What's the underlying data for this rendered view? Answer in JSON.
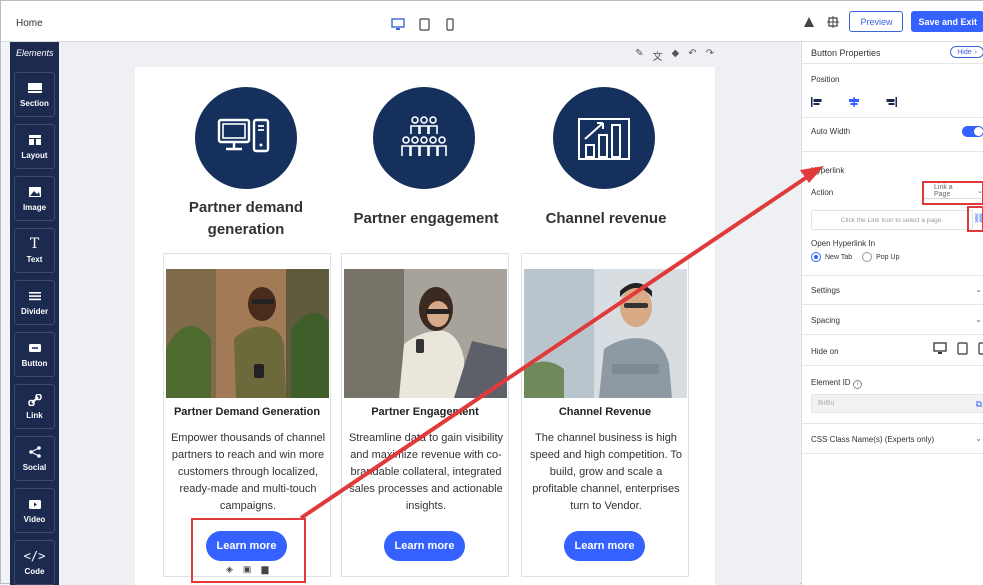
{
  "topbar": {
    "home": "Home",
    "preview": "Preview",
    "save": "Save and Exit"
  },
  "sidebar": {
    "title": "Elements",
    "items": [
      {
        "label": "Section",
        "icon": "section-icon"
      },
      {
        "label": "Layout",
        "icon": "layout-icon"
      },
      {
        "label": "Image",
        "icon": "image-icon"
      },
      {
        "label": "Text",
        "icon": "text-icon"
      },
      {
        "label": "Divider",
        "icon": "divider-icon"
      },
      {
        "label": "Button",
        "icon": "button-icon"
      },
      {
        "label": "Link",
        "icon": "link-icon"
      },
      {
        "label": "Social",
        "icon": "social-icon"
      },
      {
        "label": "Video",
        "icon": "video-icon"
      },
      {
        "label": "Code",
        "icon": "code-icon"
      }
    ]
  },
  "canvas": {
    "headings": [
      "Partner demand generation",
      "Partner engagement",
      "Channel revenue"
    ],
    "cards": [
      {
        "title": "Partner Demand Generation",
        "body": "Empower thousands of channel partners to reach and win more customers through localized, ready-made and multi-touch campaigns.",
        "button": "Learn more"
      },
      {
        "title": "Partner Engagement",
        "body": "Streamline data to gain visibility and maximize revenue with co-brandable collateral, integrated sales processes and actionable insights.",
        "button": "Learn more"
      },
      {
        "title": "Channel Revenue",
        "body": "The channel business is high speed and high competition. To build, grow and scale a profitable channel, enterprises turn to Vendor.",
        "button": "Learn more"
      }
    ],
    "accent_color": "#3461ff",
    "circle_color": "#16305e",
    "highlight_color": "#e03a3a"
  },
  "panel": {
    "title": "Button Properties",
    "hide": "Hide",
    "position_label": "Position",
    "auto_width": "Auto Width",
    "hyperlink": "Hyperlink",
    "action_label": "Action",
    "action_value": "Link a Page",
    "link_placeholder": "Click the Link Icon to select a page.",
    "open_in": "Open Hyperlink In",
    "new_tab": "New Tab",
    "pop_up": "Pop Up",
    "settings": "Settings",
    "spacing": "Spacing",
    "hide_on": "Hide on",
    "element_id": "Element ID",
    "element_id_value": "8irBu",
    "css_class": "CSS Class Name(s) (Experts only)"
  }
}
